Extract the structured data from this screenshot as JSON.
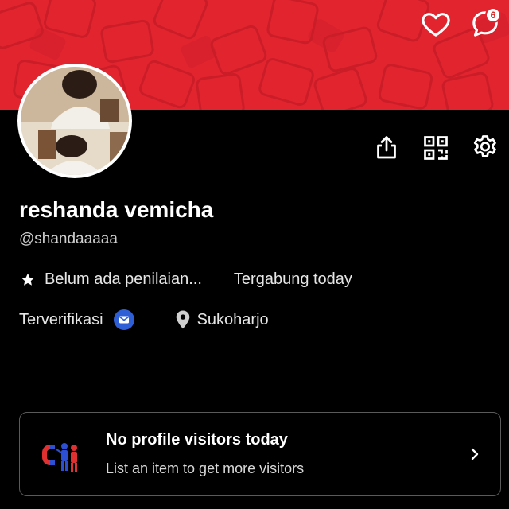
{
  "header": {
    "notification_count": "6",
    "icons": [
      "heart-icon",
      "chat-icon"
    ]
  },
  "profile": {
    "display_name": "reshanda vemicha",
    "username": "@shandaaaaa",
    "rating_text": "Belum ada penilaian...",
    "joined_text": "Tergabung today",
    "verified_text": "Terverifikasi",
    "location_text": "Sukoharjo"
  },
  "toolbar": {
    "icons": [
      "share-icon",
      "qr-code-icon",
      "gear-icon"
    ]
  },
  "visitors_card": {
    "title": "No profile visitors today",
    "subtitle": "List an item to get more visitors"
  },
  "colors": {
    "banner": "#e2242f",
    "background": "#000000",
    "verified_badge": "#2f5fd6",
    "text_secondary": "#cfcfcf"
  }
}
